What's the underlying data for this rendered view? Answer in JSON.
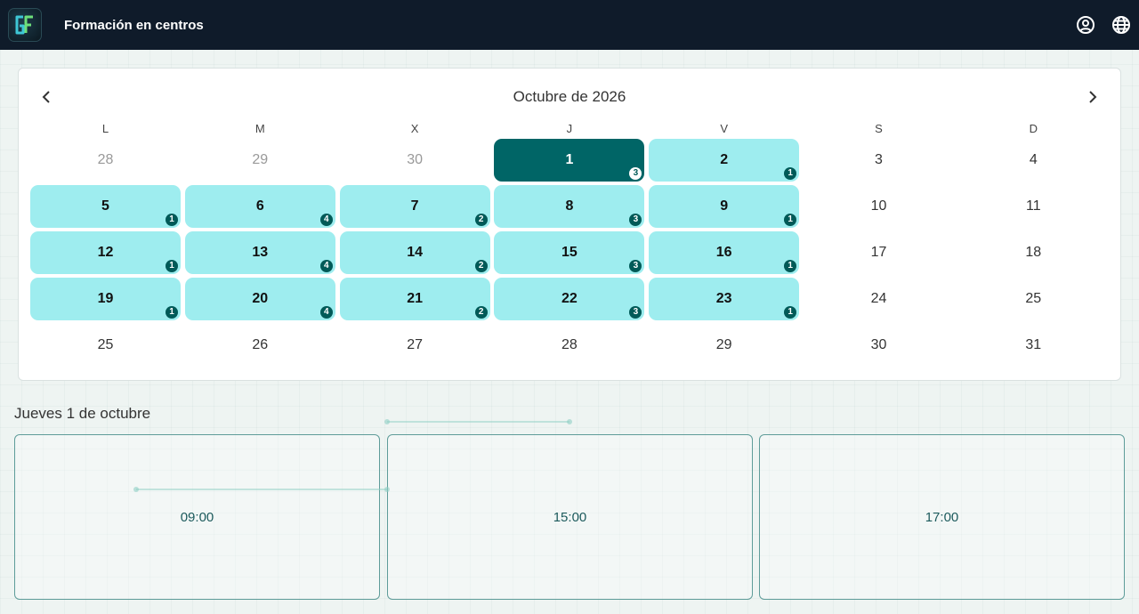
{
  "app": {
    "title": "Formación en centros",
    "logo_icon": "gf-logo-icon"
  },
  "header_icons": [
    "account-icon",
    "globe-icon"
  ],
  "calendar": {
    "month_title": "Octubre de 2026",
    "prev_icon": "chevron-left-icon",
    "next_icon": "chevron-right-icon",
    "weekdays": [
      "L",
      "M",
      "X",
      "J",
      "V",
      "S",
      "D"
    ],
    "weeks": [
      [
        {
          "day": "28",
          "state": "muted"
        },
        {
          "day": "29",
          "state": "muted"
        },
        {
          "day": "30",
          "state": "muted"
        },
        {
          "day": "1",
          "state": "selected",
          "count": "3"
        },
        {
          "day": "2",
          "state": "available",
          "count": "1"
        },
        {
          "day": "3",
          "state": "plain"
        },
        {
          "day": "4",
          "state": "plain"
        }
      ],
      [
        {
          "day": "5",
          "state": "available",
          "count": "1"
        },
        {
          "day": "6",
          "state": "available",
          "count": "4"
        },
        {
          "day": "7",
          "state": "available",
          "count": "2"
        },
        {
          "day": "8",
          "state": "available",
          "count": "3"
        },
        {
          "day": "9",
          "state": "available",
          "count": "1"
        },
        {
          "day": "10",
          "state": "plain"
        },
        {
          "day": "11",
          "state": "plain"
        }
      ],
      [
        {
          "day": "12",
          "state": "available",
          "count": "1"
        },
        {
          "day": "13",
          "state": "available",
          "count": "4"
        },
        {
          "day": "14",
          "state": "available",
          "count": "2"
        },
        {
          "day": "15",
          "state": "available",
          "count": "3"
        },
        {
          "day": "16",
          "state": "available",
          "count": "1"
        },
        {
          "day": "17",
          "state": "plain"
        },
        {
          "day": "18",
          "state": "plain"
        }
      ],
      [
        {
          "day": "19",
          "state": "available",
          "count": "1"
        },
        {
          "day": "20",
          "state": "available",
          "count": "4"
        },
        {
          "day": "21",
          "state": "available",
          "count": "2"
        },
        {
          "day": "22",
          "state": "available",
          "count": "3"
        },
        {
          "day": "23",
          "state": "available",
          "count": "1"
        },
        {
          "day": "24",
          "state": "plain"
        },
        {
          "day": "25",
          "state": "plain"
        }
      ],
      [
        {
          "day": "25",
          "state": "plain"
        },
        {
          "day": "26",
          "state": "plain"
        },
        {
          "day": "27",
          "state": "plain"
        },
        {
          "day": "28",
          "state": "plain"
        },
        {
          "day": "29",
          "state": "plain"
        },
        {
          "day": "30",
          "state": "plain"
        },
        {
          "day": "31",
          "state": "plain"
        }
      ]
    ]
  },
  "selected_date_label": "Jueves 1 de octubre",
  "time_slots": [
    "09:00",
    "15:00",
    "17:00"
  ],
  "colors": {
    "topbar": "#0f1b2a",
    "available": "#9eedef",
    "selected": "#006566",
    "badge": "#005a58",
    "slot_border": "#5e9c99"
  }
}
